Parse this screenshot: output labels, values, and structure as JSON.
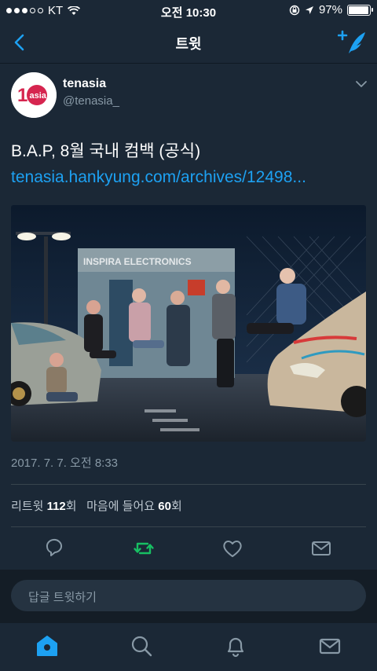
{
  "status_bar": {
    "carrier": "KT",
    "time": "오전 10:30",
    "battery": "97%"
  },
  "nav": {
    "title": "트윗"
  },
  "tweet": {
    "author_name": "tenasia",
    "author_handle": "@tenasia_",
    "text": "B.A.P, 8월 국내 컴백 (공식)",
    "link": "tenasia.hankyung.com/archives/12498...",
    "timestamp": "2017. 7. 7. 오전 8:33",
    "retweets_label": "리트윗",
    "retweets_count": "112",
    "retweets_unit": "회",
    "likes_label": "마음에 들어요",
    "likes_count": "60",
    "likes_unit": "회",
    "image_sign_text": "INSPIRA ELECTRONICS"
  },
  "reply": {
    "placeholder": "답글 트윗하기"
  },
  "icons": {
    "back": "chevron-left-icon",
    "compose": "compose-tweet-icon",
    "more": "chevron-down-icon",
    "reply": "reply-icon",
    "retweet": "retweet-icon",
    "like": "heart-icon",
    "dm": "mail-icon",
    "home": "home-icon",
    "search": "search-icon",
    "notifications": "bell-icon",
    "messages": "mail-icon"
  },
  "colors": {
    "background": "#1b2836",
    "accent": "#1da1f2",
    "retweet_active": "#17bf63",
    "muted": "#8899a6"
  }
}
